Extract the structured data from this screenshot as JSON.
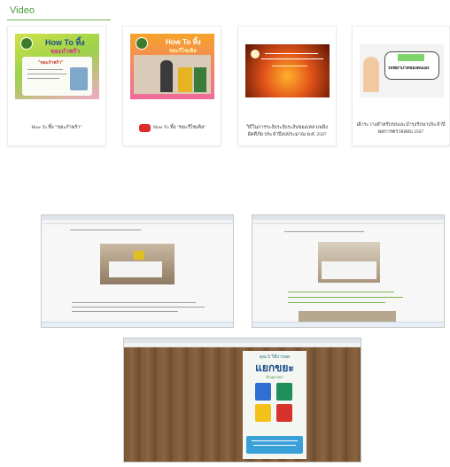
{
  "section": {
    "title": "Video"
  },
  "videos": [
    {
      "caption": "How To ทิ้ง \"ขยะกำพร้า\"",
      "thumb_heading": "How To ทิ้ง",
      "thumb_sub": "ขยะกำพร้า",
      "thumb_tag": "\"ขยะกำพร้า\""
    },
    {
      "caption": "How To ทิ้ง \"ขยะรีไซเคิล\"",
      "thumb_heading": "How To ทิ้ง",
      "thumb_sub": "ขยะรีไซเคิล"
    },
    {
      "caption": "วิธีในการระงับระงับระงับของเหลวเพลิง อัคคีภัย ประจำปีงบประมาณ พ.ศ. 2567"
    },
    {
      "caption": "เฝ้าระวางสำหรับรถและบำรุงรักษาประจำปี ผลการตรวจสอบ 2567",
      "thumb_tag": "รถพยาบาลของตนเอง"
    }
  ],
  "poster": {
    "top": "คุณ 5 วิธีการลด",
    "title": "แยกขยะ",
    "tag": "บ้านบางนา"
  },
  "colors": {
    "accent": "#6cb64f",
    "caption": "#333333"
  }
}
